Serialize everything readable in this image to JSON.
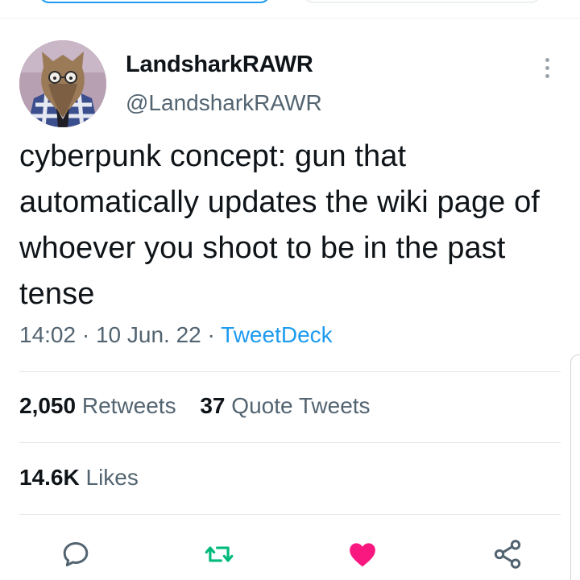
{
  "tweet": {
    "display_name": "LandsharkRAWR",
    "handle": "@LandsharkRAWR",
    "text": "cyberpunk concept: gun that automatically updates the wiki page of whoever you shoot to be in the past tense",
    "time": "14:02",
    "date": "10 Jun. 22",
    "separator": "·",
    "source": "TweetDeck"
  },
  "stats": {
    "retweets_count": "2,050",
    "retweets_label": "Retweets",
    "quotes_count": "37",
    "quotes_label": "Quote Tweets",
    "likes_count": "14.6K",
    "likes_label": "Likes"
  },
  "actions": {
    "reply_icon": "reply-icon",
    "retweet_icon": "retweet-icon",
    "like_icon": "heart-icon",
    "share_icon": "share-icon"
  },
  "colors": {
    "accent": "#1d9bf0",
    "secondary_text": "#536471",
    "retweet": "#00ba7c",
    "like": "#f91880"
  }
}
